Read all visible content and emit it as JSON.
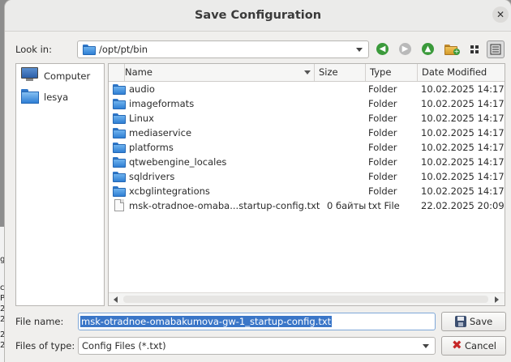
{
  "window": {
    "title": "Save Configuration",
    "close_glyph": "✕"
  },
  "background_fragments": [
    "g",
    "c",
    "P",
    "2",
    "2",
    "2",
    "2"
  ],
  "look_in": {
    "label": "Look in:",
    "path": "/opt/pt/bin"
  },
  "toolbar": {
    "icons": [
      "back-arrow-icon",
      "forward-arrow-icon",
      "parent-folder-icon",
      "new-folder-icon",
      "icon-view-icon",
      "detail-view-icon"
    ],
    "colors": {
      "back": "#3b9a3b",
      "forward": "#b9b9b9",
      "up": "#3b9a3b"
    }
  },
  "sidebar": {
    "items": [
      {
        "label": "Computer",
        "icon": "computer-icon"
      },
      {
        "label": "lesya",
        "icon": "home-folder-icon"
      }
    ]
  },
  "file_list": {
    "columns": [
      "Name",
      "Size",
      "Type",
      "Date Modified"
    ],
    "rows": [
      {
        "name": "audio",
        "size": "",
        "type": "Folder",
        "date": "10.02.2025 14:17",
        "icon": "folder-icon"
      },
      {
        "name": "imageformats",
        "size": "",
        "type": "Folder",
        "date": "10.02.2025 14:17",
        "icon": "folder-icon"
      },
      {
        "name": "Linux",
        "size": "",
        "type": "Folder",
        "date": "10.02.2025 14:17",
        "icon": "folder-icon"
      },
      {
        "name": "mediaservice",
        "size": "",
        "type": "Folder",
        "date": "10.02.2025 14:17",
        "icon": "folder-icon"
      },
      {
        "name": "platforms",
        "size": "",
        "type": "Folder",
        "date": "10.02.2025 14:17",
        "icon": "folder-icon"
      },
      {
        "name": "qtwebengine_locales",
        "size": "",
        "type": "Folder",
        "date": "10.02.2025 14:17",
        "icon": "folder-icon"
      },
      {
        "name": "sqldrivers",
        "size": "",
        "type": "Folder",
        "date": "10.02.2025 14:17",
        "icon": "folder-icon"
      },
      {
        "name": "xcbglintegrations",
        "size": "",
        "type": "Folder",
        "date": "10.02.2025 14:17",
        "icon": "folder-icon"
      },
      {
        "name": "msk-otradnoe-omaba...startup-config.txt",
        "size": "0 байты",
        "type": "txt File",
        "date": "22.02.2025 20:09",
        "icon": "text-file-icon"
      }
    ]
  },
  "file_name": {
    "label": "File name:",
    "value": "msk-otradnoe-omabakumova-gw-1_startup-config.txt"
  },
  "file_type": {
    "label": "Files of type:",
    "value": "Config Files (*.txt)"
  },
  "buttons": {
    "save": "Save",
    "cancel": "Cancel"
  }
}
